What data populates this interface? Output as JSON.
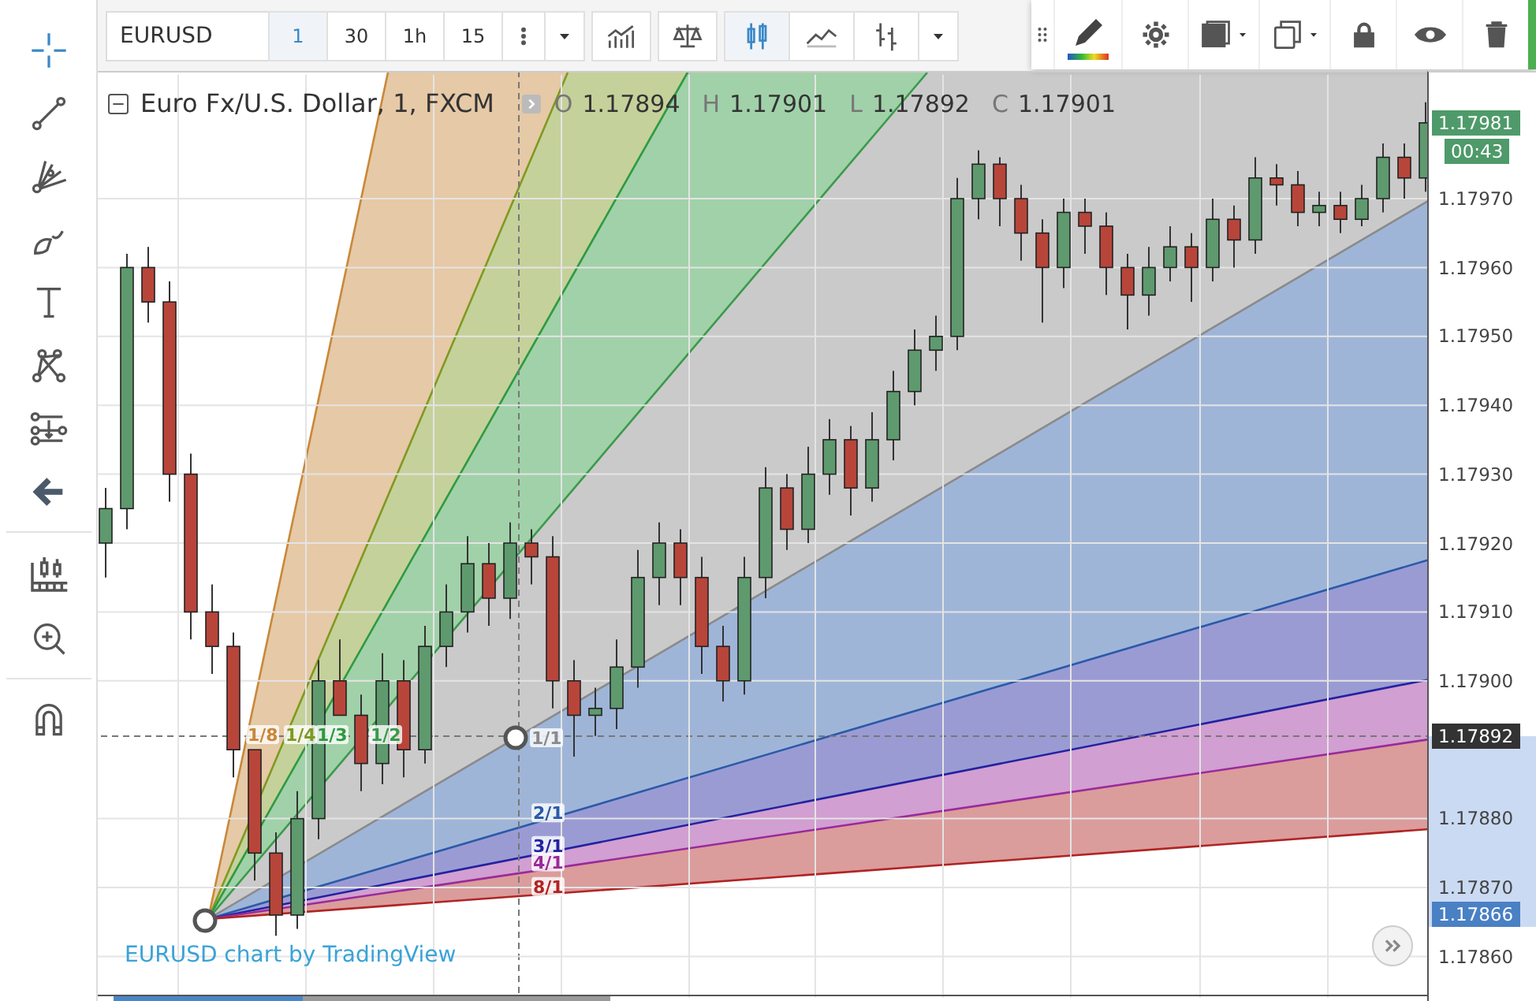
{
  "toolbar": {
    "symbol": "EURUSD",
    "intervals": [
      {
        "label": "1",
        "selected": true
      },
      {
        "label": "30",
        "selected": false
      },
      {
        "label": "1h",
        "selected": false
      },
      {
        "label": "15",
        "selected": false
      }
    ],
    "chart_types": [
      {
        "kind": "candles",
        "selected": true
      },
      {
        "kind": "line",
        "selected": false
      },
      {
        "kind": "bars",
        "selected": false
      }
    ]
  },
  "chart": {
    "title": "Euro Fx/U.S. Dollar, 1, FXCM",
    "ohlc": [
      {
        "key": "O",
        "value": "1.17894"
      },
      {
        "key": "H",
        "value": "1.17901"
      },
      {
        "key": "L",
        "value": "1.17892"
      },
      {
        "key": "C",
        "value": "1.17901"
      }
    ],
    "branding": "EURUSD chart by TradingView",
    "fan_levels": [
      {
        "label": "1/8",
        "color": "#c8883a"
      },
      {
        "label": "1/4",
        "color": "#7e9a20"
      },
      {
        "label": "1/3",
        "color": "#2e9a40"
      },
      {
        "label": "1/2",
        "color": "#3a9a4a"
      },
      {
        "label": "1/1",
        "color": "#8a8a8a"
      },
      {
        "label": "2/1",
        "color": "#2a5aa8"
      },
      {
        "label": "3/1",
        "color": "#2222a0"
      },
      {
        "label": "4/1",
        "color": "#9a2a9a"
      },
      {
        "label": "8/1",
        "color": "#b02424"
      }
    ],
    "chart_data": {
      "type": "candlestick",
      "grid": true,
      "ylim": [
        1.17854,
        1.17988
      ],
      "ohlc": [
        [
          1.1792,
          1.17928,
          1.17915,
          1.17925
        ],
        [
          1.17925,
          1.17962,
          1.17922,
          1.1796
        ],
        [
          1.1796,
          1.17963,
          1.17952,
          1.17955
        ],
        [
          1.17955,
          1.17958,
          1.17926,
          1.1793
        ],
        [
          1.1793,
          1.17933,
          1.17906,
          1.1791
        ],
        [
          1.1791,
          1.17914,
          1.17901,
          1.17905
        ],
        [
          1.17905,
          1.17907,
          1.17886,
          1.1789
        ],
        [
          1.1789,
          1.1789,
          1.17871,
          1.17875
        ],
        [
          1.17875,
          1.17878,
          1.17863,
          1.17866
        ],
        [
          1.17866,
          1.17884,
          1.17864,
          1.1788
        ],
        [
          1.1788,
          1.17903,
          1.17877,
          1.179
        ],
        [
          1.179,
          1.17906,
          1.17895,
          1.17895
        ],
        [
          1.17895,
          1.17898,
          1.17884,
          1.17888
        ],
        [
          1.17888,
          1.17904,
          1.17885,
          1.179
        ],
        [
          1.179,
          1.17903,
          1.17886,
          1.1789
        ],
        [
          1.1789,
          1.17908,
          1.17888,
          1.17905
        ],
        [
          1.17905,
          1.17914,
          1.17902,
          1.1791
        ],
        [
          1.1791,
          1.17921,
          1.17907,
          1.17917
        ],
        [
          1.17917,
          1.1792,
          1.17908,
          1.17912
        ],
        [
          1.17912,
          1.17923,
          1.17909,
          1.1792
        ],
        [
          1.1792,
          1.17922,
          1.17914,
          1.17918
        ],
        [
          1.17918,
          1.17921,
          1.17896,
          1.179
        ],
        [
          1.179,
          1.17903,
          1.17889,
          1.17895
        ],
        [
          1.17895,
          1.17899,
          1.17892,
          1.17896
        ],
        [
          1.17896,
          1.17906,
          1.17893,
          1.17902
        ],
        [
          1.17902,
          1.17919,
          1.17899,
          1.17915
        ],
        [
          1.17915,
          1.17923,
          1.17911,
          1.1792
        ],
        [
          1.1792,
          1.17922,
          1.17911,
          1.17915
        ],
        [
          1.17915,
          1.17918,
          1.17901,
          1.17905
        ],
        [
          1.17905,
          1.17908,
          1.17897,
          1.179
        ],
        [
          1.179,
          1.17918,
          1.17898,
          1.17915
        ],
        [
          1.17915,
          1.17931,
          1.17912,
          1.17928
        ],
        [
          1.17928,
          1.1793,
          1.17919,
          1.17922
        ],
        [
          1.17922,
          1.17934,
          1.1792,
          1.1793
        ],
        [
          1.1793,
          1.17938,
          1.17927,
          1.17935
        ],
        [
          1.17935,
          1.17937,
          1.17924,
          1.17928
        ],
        [
          1.17928,
          1.17939,
          1.17926,
          1.17935
        ],
        [
          1.17935,
          1.17945,
          1.17932,
          1.17942
        ],
        [
          1.17942,
          1.17951,
          1.1794,
          1.17948
        ],
        [
          1.17948,
          1.17953,
          1.17945,
          1.1795
        ],
        [
          1.1795,
          1.17973,
          1.17948,
          1.1797
        ],
        [
          1.1797,
          1.17977,
          1.17967,
          1.17975
        ],
        [
          1.17975,
          1.17976,
          1.17966,
          1.1797
        ],
        [
          1.1797,
          1.17972,
          1.17961,
          1.17965
        ],
        [
          1.17965,
          1.17967,
          1.17952,
          1.1796
        ],
        [
          1.1796,
          1.1797,
          1.17957,
          1.17968
        ],
        [
          1.17968,
          1.1797,
          1.17962,
          1.17966
        ],
        [
          1.17966,
          1.17968,
          1.17956,
          1.1796
        ],
        [
          1.1796,
          1.17962,
          1.17951,
          1.17956
        ],
        [
          1.17956,
          1.17963,
          1.17953,
          1.1796
        ],
        [
          1.1796,
          1.17966,
          1.17958,
          1.17963
        ],
        [
          1.17963,
          1.17965,
          1.17955,
          1.1796
        ],
        [
          1.1796,
          1.1797,
          1.17958,
          1.17967
        ],
        [
          1.17967,
          1.17969,
          1.1796,
          1.17964
        ],
        [
          1.17964,
          1.17976,
          1.17962,
          1.17973
        ],
        [
          1.17973,
          1.17975,
          1.17969,
          1.17972
        ],
        [
          1.17972,
          1.17974,
          1.17966,
          1.17968
        ],
        [
          1.17968,
          1.17971,
          1.17966,
          1.17969
        ],
        [
          1.17969,
          1.17971,
          1.17965,
          1.17967
        ],
        [
          1.17967,
          1.17972,
          1.17966,
          1.1797
        ],
        [
          1.1797,
          1.17978,
          1.17968,
          1.17976
        ],
        [
          1.17976,
          1.17978,
          1.1797,
          1.17973
        ],
        [
          1.17973,
          1.17984,
          1.17971,
          1.17981
        ]
      ],
      "yticks": [
        {
          "value": 1.1797,
          "label": "1.17970"
        },
        {
          "value": 1.1796,
          "label": "1.17960"
        },
        {
          "value": 1.1795,
          "label": "1.17950"
        },
        {
          "value": 1.1794,
          "label": "1.17940"
        },
        {
          "value": 1.1793,
          "label": "1.17930"
        },
        {
          "value": 1.1792,
          "label": "1.17920"
        },
        {
          "value": 1.1791,
          "label": "1.17910"
        },
        {
          "value": 1.179,
          "label": "1.17900"
        },
        {
          "value": 1.1788,
          "label": "1.17880"
        },
        {
          "value": 1.1787,
          "label": "1.17870"
        },
        {
          "value": 1.1786,
          "label": "1.17860"
        }
      ]
    }
  },
  "price_axis": {
    "last_price": "1.17981",
    "countdown": "00:43",
    "crosshair_price": "1.17892",
    "anchor_price": "1.17866"
  }
}
